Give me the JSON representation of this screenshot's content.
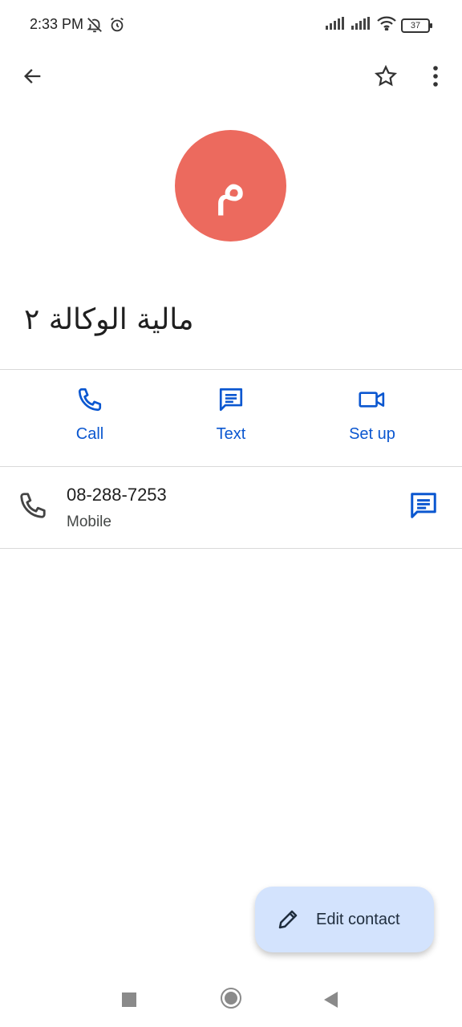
{
  "status_bar": {
    "time": "2:33 PM",
    "battery": "37",
    "icons_left": [
      "bell-off-icon",
      "alarm-icon"
    ],
    "icons_right": [
      "signal-icon",
      "signal-icon",
      "wifi-icon",
      "battery-icon"
    ]
  },
  "app_bar": {
    "back_icon": "arrow-back-icon",
    "favorite_icon": "star-outline-icon",
    "more_icon": "more-vert-icon"
  },
  "contact": {
    "avatar_letter": "م",
    "avatar_color": "#ec6a5e",
    "name": "مالية الوكالة ٢"
  },
  "actions": [
    {
      "label": "Call",
      "icon": "phone-icon"
    },
    {
      "label": "Text",
      "icon": "message-icon"
    },
    {
      "label": "Set up",
      "icon": "video-call-icon"
    }
  ],
  "phone_entry": {
    "number": "08-288-7253",
    "type": "Mobile",
    "icon": "phone-icon",
    "action_icon": "message-icon"
  },
  "fab": {
    "label": "Edit contact",
    "icon": "edit-pencil-icon"
  },
  "colors": {
    "accent": "#0b57d0",
    "fab_background": "#d3e3fd",
    "divider": "#d9d9d9"
  },
  "nav_bar": {
    "items": [
      "recents-square-icon",
      "home-circle-icon",
      "back-triangle-icon"
    ]
  }
}
